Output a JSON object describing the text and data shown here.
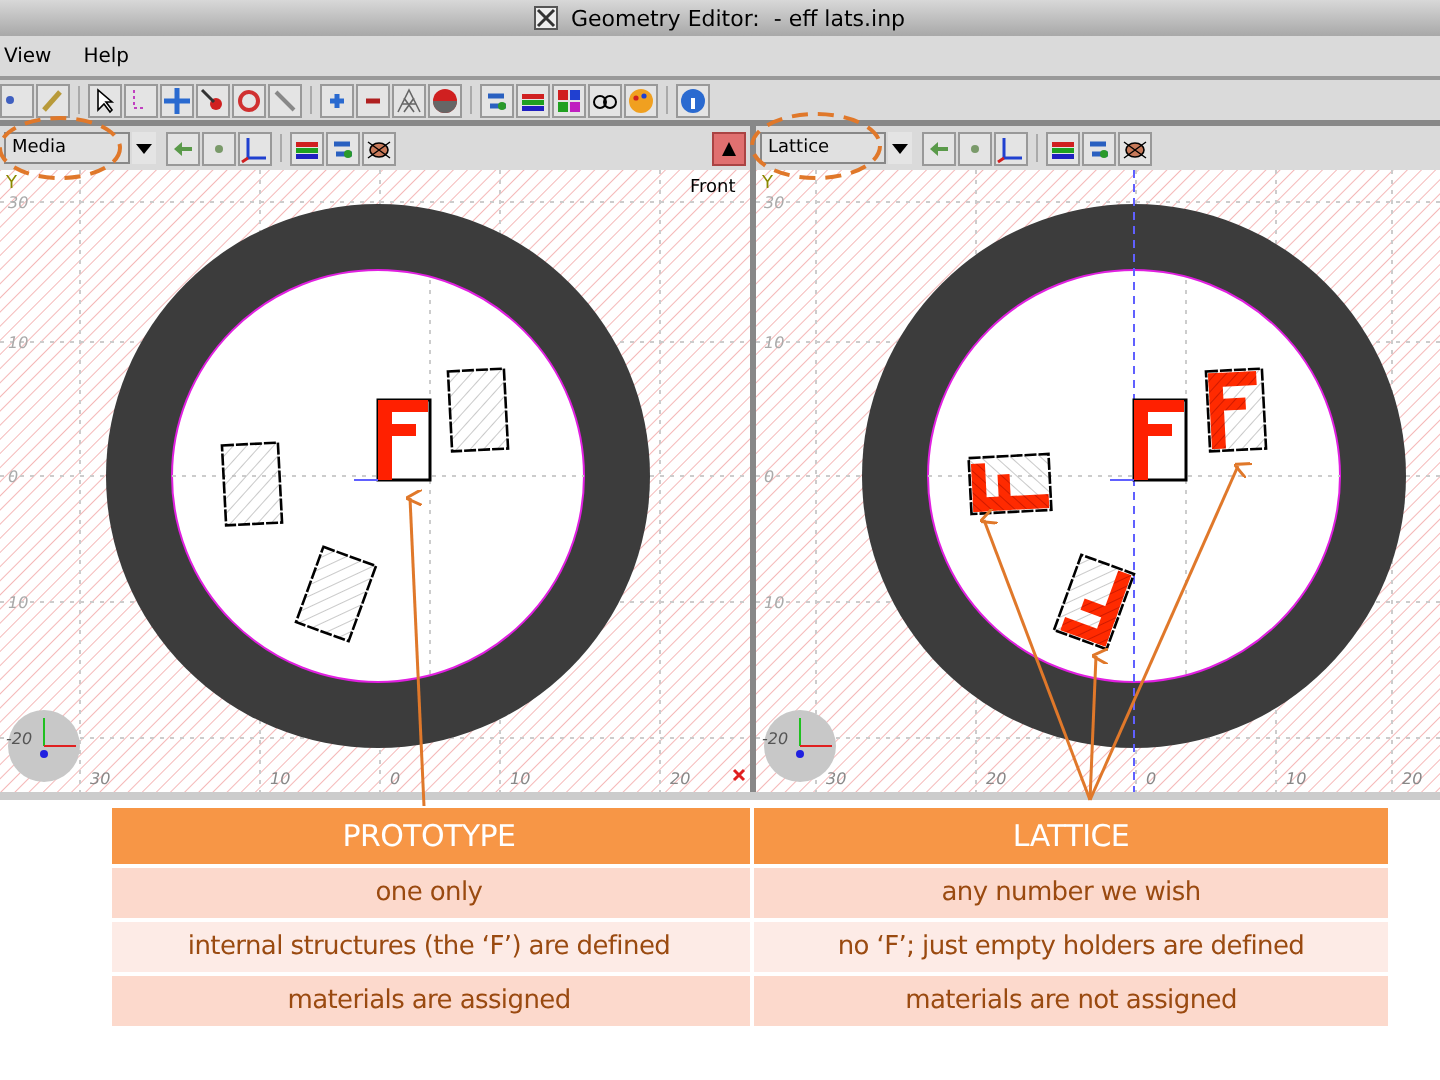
{
  "window": {
    "title": "Geometry Editor:  - eff lats.inp"
  },
  "menu": [
    "View",
    "Help"
  ],
  "panes": [
    {
      "kind": "prototype",
      "view_selector": "Media",
      "view_label": "Front",
      "axis_y": "Y",
      "y_ticks": [
        "30",
        "10",
        "0",
        "10",
        "-20"
      ],
      "x_ticks": [
        "30",
        "10",
        "0",
        "10",
        "20"
      ]
    },
    {
      "kind": "lattice",
      "view_selector": "Lattice",
      "axis_y": "Y",
      "y_ticks": [
        "30",
        "10",
        "0",
        "10",
        "-20"
      ],
      "x_ticks": [
        "30",
        "20",
        "0",
        "10",
        "20"
      ]
    }
  ],
  "table": {
    "columns": [
      "PROTOTYPE",
      "LATTICE"
    ],
    "rows": [
      [
        "one only",
        "any number we wish"
      ],
      [
        "internal structures  (the ‘F’) are defined",
        "no ‘F’; just empty holders are defined"
      ],
      [
        "materials are assigned",
        "materials are not assigned"
      ]
    ]
  }
}
